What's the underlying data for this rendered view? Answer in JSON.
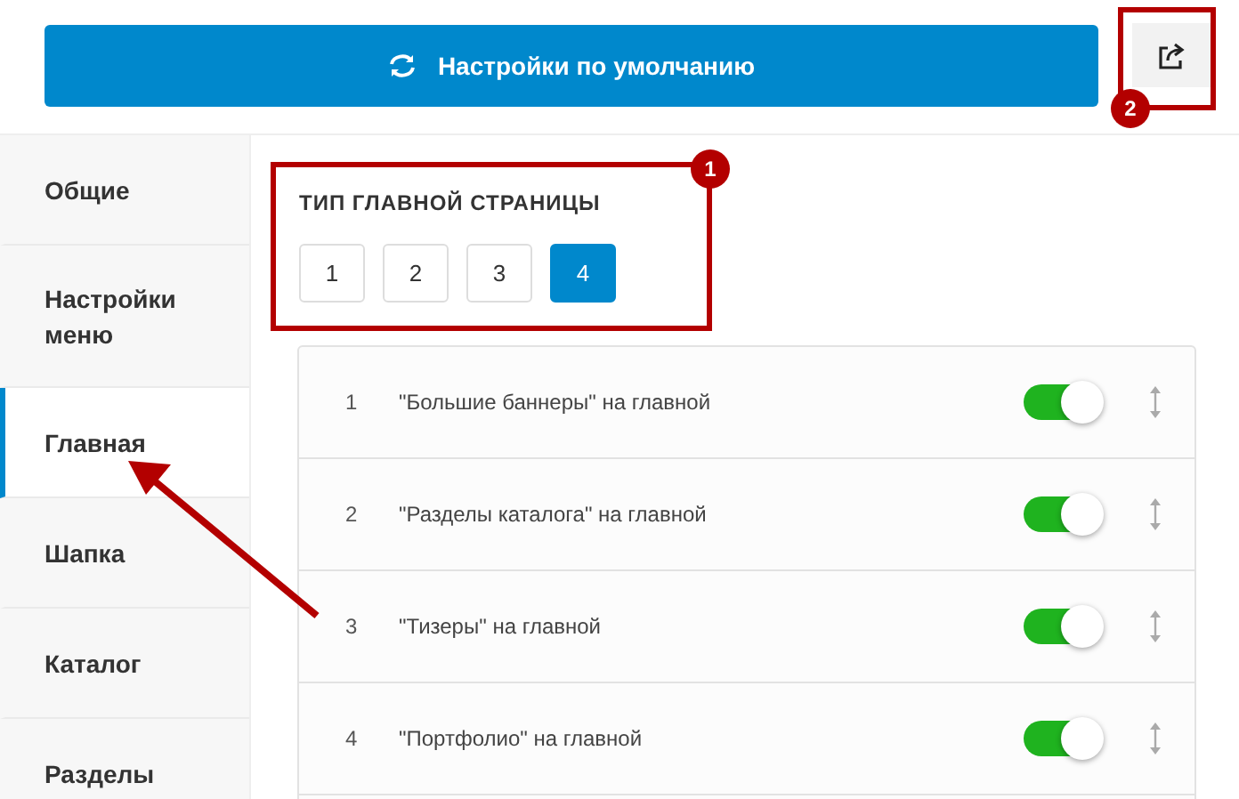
{
  "toolbar": {
    "reset_button": {
      "label": "Настройки по умолчанию"
    }
  },
  "sidebar": {
    "items": [
      {
        "label": "Общие",
        "selected": false
      },
      {
        "label": "Настройки меню",
        "selected": false
      },
      {
        "label": "Главная",
        "selected": true
      },
      {
        "label": "Шапка",
        "selected": false
      },
      {
        "label": "Каталог",
        "selected": false
      },
      {
        "label": "Разделы",
        "selected": false
      }
    ]
  },
  "page_type": {
    "title": "ТИП ГЛАВНОЙ СТРАНИЦЫ",
    "options": [
      {
        "label": "1",
        "selected": false
      },
      {
        "label": "2",
        "selected": false
      },
      {
        "label": "3",
        "selected": false
      },
      {
        "label": "4",
        "selected": true
      }
    ]
  },
  "blocks": [
    {
      "number": "1",
      "label": "\"Большие баннеры\" на главной",
      "on": true
    },
    {
      "number": "2",
      "label": "\"Разделы каталога\" на главной",
      "on": true
    },
    {
      "number": "3",
      "label": "\"Тизеры\" на главной",
      "on": true
    },
    {
      "number": "4",
      "label": "\"Портфолио\" на главной",
      "on": true
    }
  ],
  "annotations": [
    {
      "number": "1"
    },
    {
      "number": "2"
    }
  ]
}
